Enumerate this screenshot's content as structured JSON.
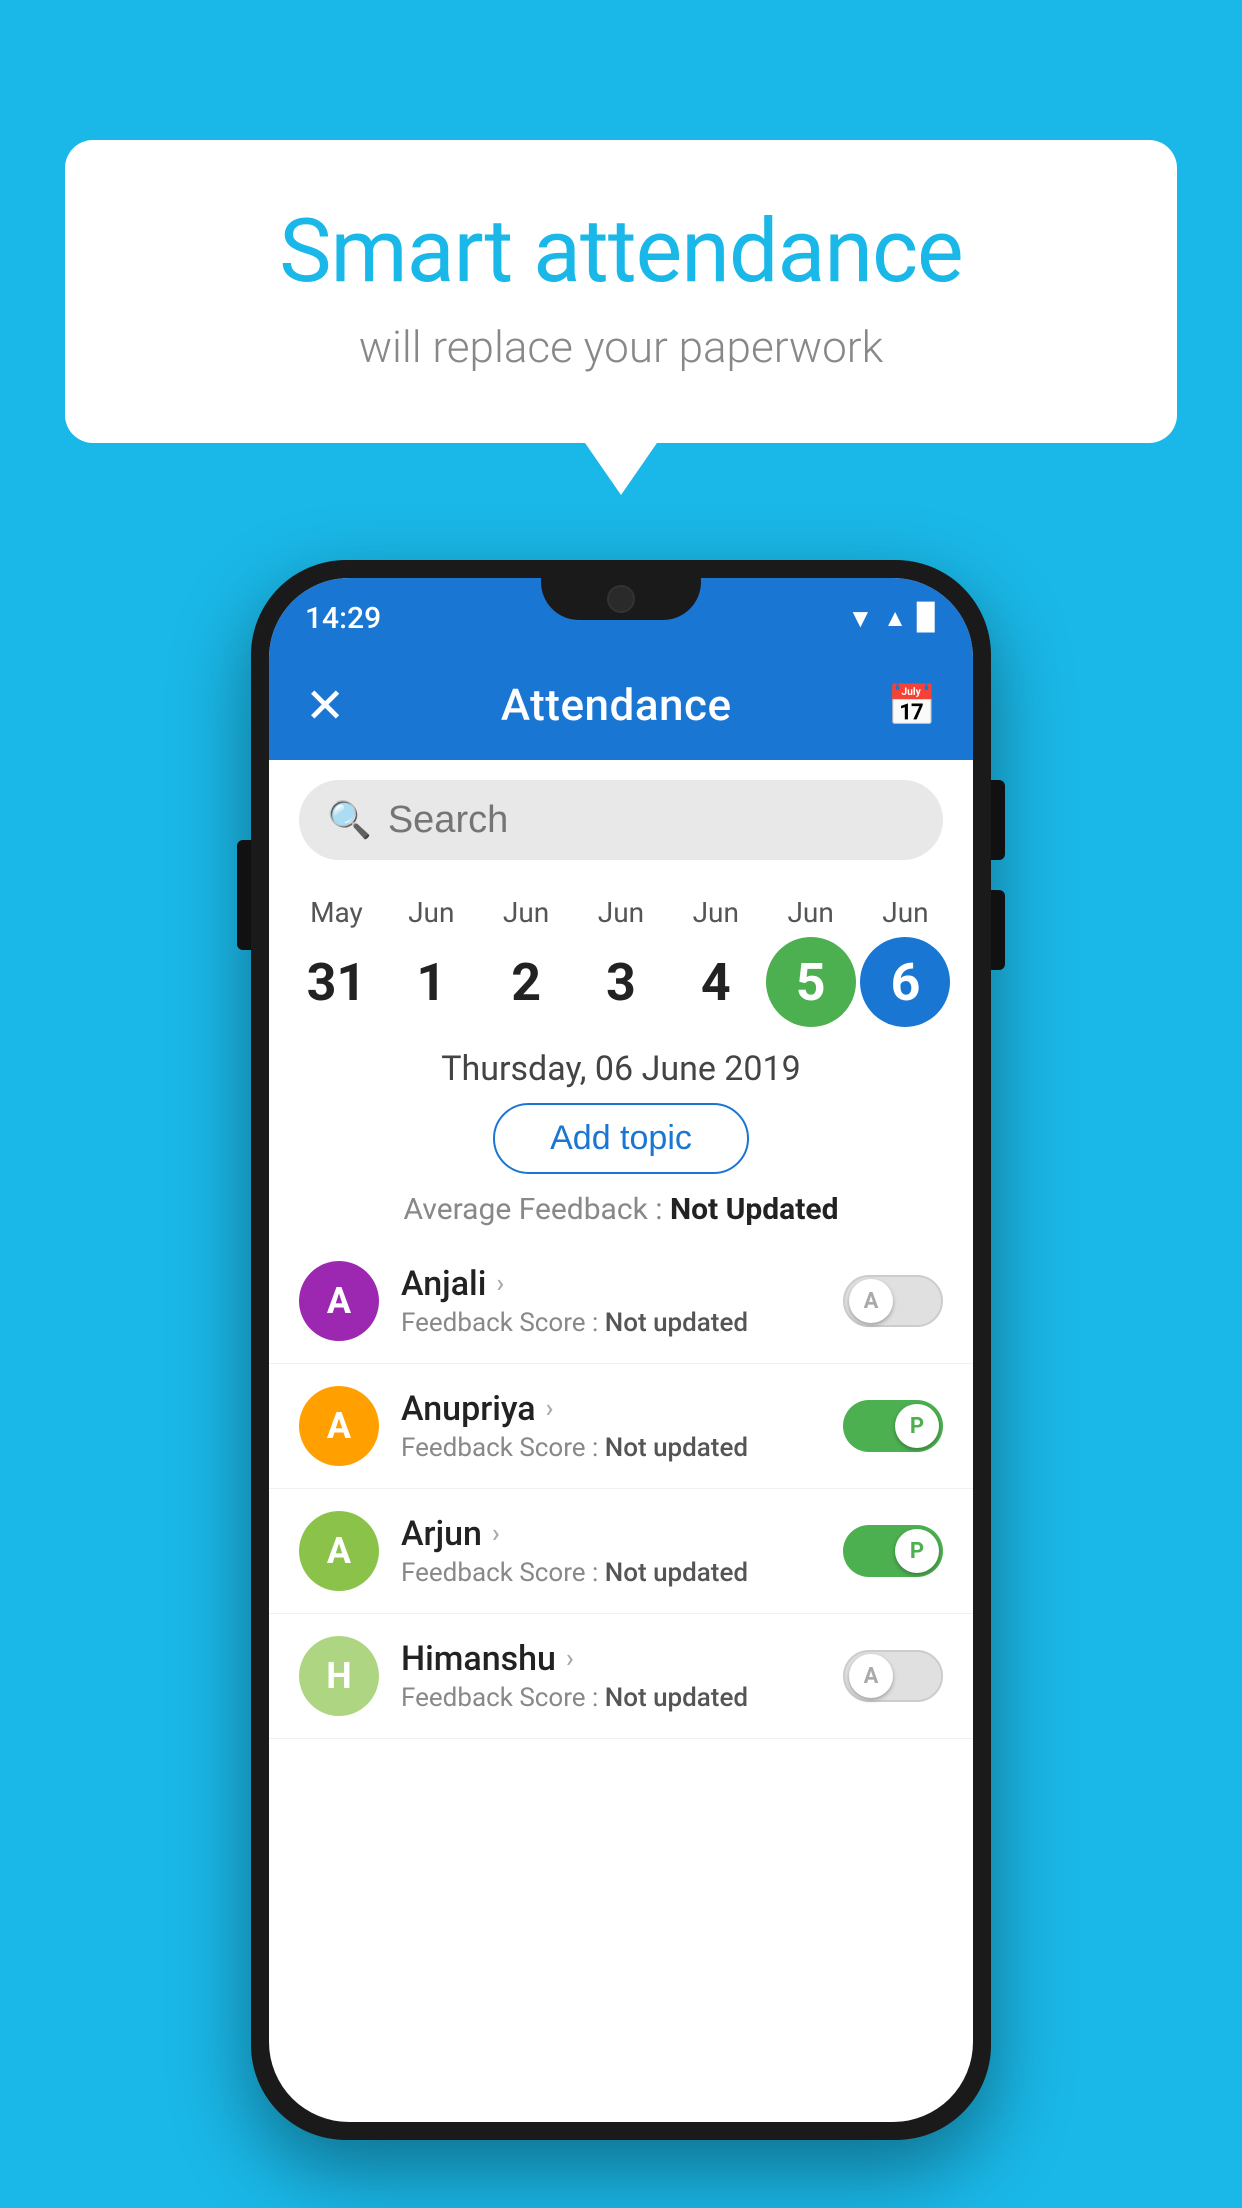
{
  "background_color": "#1ab8e8",
  "bubble": {
    "title": "Smart attendance",
    "subtitle": "will replace your paperwork"
  },
  "status_bar": {
    "time": "14:29",
    "wifi_icon": "▼",
    "signal_icon": "▲",
    "battery_icon": "▉"
  },
  "app_bar": {
    "close_label": "✕",
    "title": "Attendance",
    "calendar_icon": "📅"
  },
  "search": {
    "placeholder": "Search",
    "icon": "🔍"
  },
  "calendar": {
    "days": [
      {
        "month": "May",
        "date": "31",
        "state": "normal"
      },
      {
        "month": "Jun",
        "date": "1",
        "state": "normal"
      },
      {
        "month": "Jun",
        "date": "2",
        "state": "normal"
      },
      {
        "month": "Jun",
        "date": "3",
        "state": "normal"
      },
      {
        "month": "Jun",
        "date": "4",
        "state": "normal"
      },
      {
        "month": "Jun",
        "date": "5",
        "state": "today"
      },
      {
        "month": "Jun",
        "date": "6",
        "state": "selected"
      }
    ]
  },
  "selected_date": "Thursday, 06 June 2019",
  "add_topic_label": "Add topic",
  "average_feedback": {
    "label": "Average Feedback : ",
    "value": "Not Updated"
  },
  "students": [
    {
      "name": "Anjali",
      "avatar_letter": "A",
      "avatar_color": "#9c27b0",
      "feedback_label": "Feedback Score : ",
      "feedback_value": "Not updated",
      "toggle_state": "off",
      "toggle_letter": "A"
    },
    {
      "name": "Anupriya",
      "avatar_letter": "A",
      "avatar_color": "#ffa000",
      "feedback_label": "Feedback Score : ",
      "feedback_value": "Not updated",
      "toggle_state": "on",
      "toggle_letter": "P"
    },
    {
      "name": "Arjun",
      "avatar_letter": "A",
      "avatar_color": "#8bc34a",
      "feedback_label": "Feedback Score : ",
      "feedback_value": "Not updated",
      "toggle_state": "on",
      "toggle_letter": "P"
    },
    {
      "name": "Himanshu",
      "avatar_letter": "H",
      "avatar_color": "#aed581",
      "feedback_label": "Feedback Score : ",
      "feedback_value": "Not updated",
      "toggle_state": "off",
      "toggle_letter": "A"
    }
  ]
}
